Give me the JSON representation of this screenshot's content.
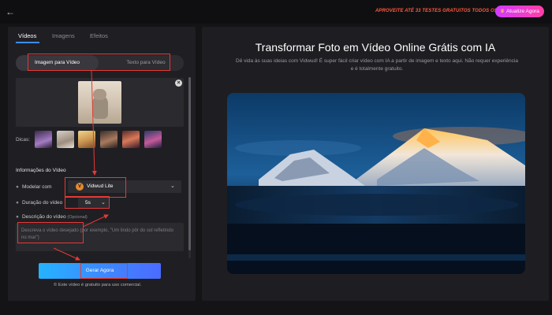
{
  "topbar": {
    "promo_text": "APROVEITE ATÉ 33 TESTES GRATUITOS TODOS OS DIAS!",
    "upgrade_label": "Atualize Agora"
  },
  "left_panel": {
    "tabs": [
      {
        "label": "Vídeos",
        "active": true
      },
      {
        "label": "Imagens",
        "active": false
      },
      {
        "label": "Efeitos",
        "active": false
      }
    ],
    "mode_switch": {
      "active": "Imagem para Vídeo",
      "inactive": "Texto para Vídeo"
    },
    "tips_label": "Dicas:",
    "section_title": "Informações do Vídeo",
    "model": {
      "label": "Modelar com",
      "value": "Vidwud Lite",
      "icon": "vidwud-logo-icon"
    },
    "duration": {
      "label": "Duração do vídeo",
      "value": "5s"
    },
    "description": {
      "label": "Descrição do vídeo",
      "optional": "(Opcional)",
      "placeholder": "Descreva o vídeo desejado (por exemplo, \"Um lindo pôr do sol refletindo no mar\")"
    },
    "generate_label": "Gerar Agora",
    "footnote": "Este vídeo é gratuito para uso comercial."
  },
  "right_panel": {
    "title": "Transformar Foto em Vídeo Online Grátis com IA",
    "subtitle": "Dê vida às suas ideias com Vidwud! É super fácil criar vídeo com IA a partir de imagem e texto aqui. Não requer experiência e é totalmente gratuito."
  },
  "colors": {
    "accent": "#3e8bff",
    "promo": "#ff5a3c",
    "annotation": "#e53935"
  }
}
